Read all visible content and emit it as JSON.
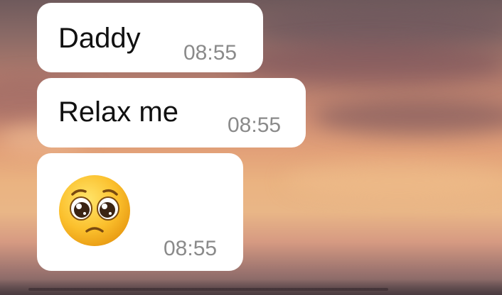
{
  "messages": [
    {
      "text": "Daddy",
      "time": "08:55"
    },
    {
      "text": "Relax me",
      "time": "08:55"
    },
    {
      "emoji": "pleading-face",
      "time": "08:55"
    }
  ]
}
